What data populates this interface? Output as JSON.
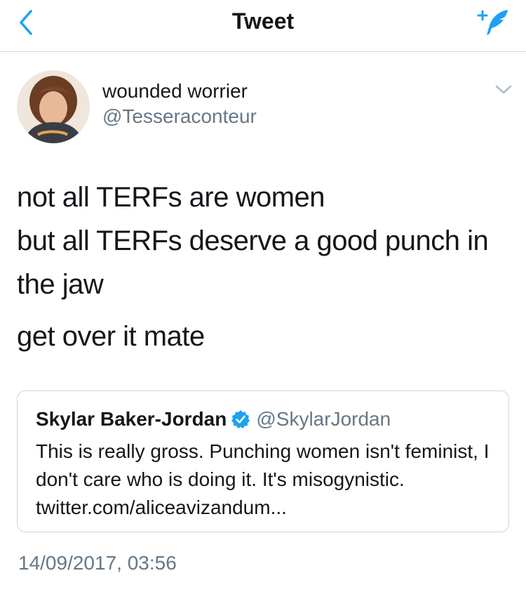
{
  "navbar": {
    "title": "Tweet",
    "back_icon": "chevron-left-icon",
    "compose_icon": "compose-tweet-icon",
    "accent_color": "#1da1f2"
  },
  "tweet": {
    "author": {
      "display_name": "wounded worrier",
      "handle": "@Tesseraconteur"
    },
    "text_lines": [
      "not all TERFs are women",
      "but all TERFs deserve a good punch in the jaw",
      "get over it mate"
    ],
    "quoted": {
      "display_name": "Skylar Baker-Jordan",
      "verified_icon": "verified-badge-icon",
      "handle": "@SkylarJordan",
      "text": "This is really gross. Punching women isn't feminist, I don't care who is doing it. It's misogynistic. twitter.com/aliceavizandum..."
    },
    "timestamp": "14/09/2017, 03:56"
  }
}
